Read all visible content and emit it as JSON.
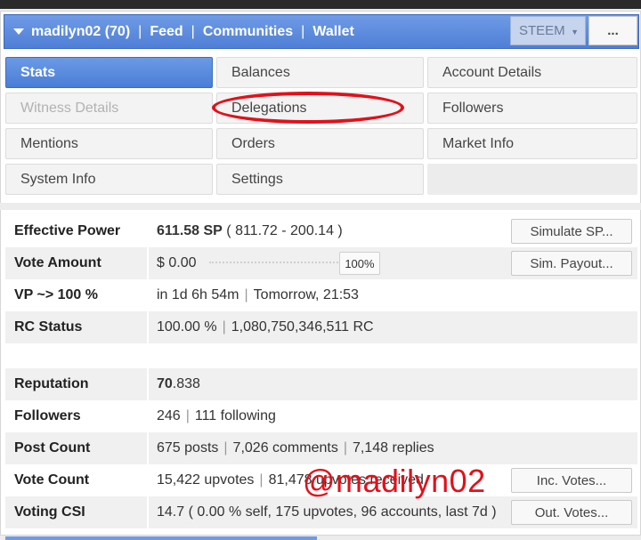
{
  "header": {
    "user": "madilyn02 (70)",
    "nav": [
      "Feed",
      "Communities",
      "Wallet"
    ],
    "separator": "|",
    "currency_select": "STEEM",
    "more_button": "..."
  },
  "tabs": [
    {
      "label": "Stats",
      "state": "active"
    },
    {
      "label": "Balances",
      "state": "normal"
    },
    {
      "label": "Account Details",
      "state": "normal"
    },
    {
      "label": "Witness Details",
      "state": "disabled"
    },
    {
      "label": "Delegations",
      "state": "normal"
    },
    {
      "label": "Followers",
      "state": "normal"
    },
    {
      "label": "Mentions",
      "state": "normal"
    },
    {
      "label": "Orders",
      "state": "normal"
    },
    {
      "label": "Market Info",
      "state": "normal"
    },
    {
      "label": "System Info",
      "state": "normal"
    },
    {
      "label": "Settings",
      "state": "normal"
    }
  ],
  "stats": {
    "effective_power": {
      "label": "Effective Power",
      "value": "611.58 SP",
      "detail": " ( 811.72 - 200.14 )",
      "button": "Simulate SP..."
    },
    "vote_amount": {
      "label": "Vote Amount",
      "value": "$ 0.00",
      "percent": "100%",
      "button": "Sim. Payout..."
    },
    "vp": {
      "label": "VP ~> 100 %",
      "time": "in 1d 6h 54m",
      "when": "Tomorrow, 21:53"
    },
    "rc_status": {
      "label": "RC Status",
      "percent": "100.00 %",
      "rc": "1,080,750,346,511 RC"
    },
    "reputation": {
      "label": "Reputation",
      "value_int": "70",
      "value_dec": ".838"
    },
    "followers": {
      "label": "Followers",
      "followers": "246",
      "following": "111 following"
    },
    "post_count": {
      "label": "Post Count",
      "posts": "675 posts",
      "comments": "7,026 comments",
      "replies": "7,148 replies"
    },
    "vote_count": {
      "label": "Vote Count",
      "upvotes": "15,422 upvotes",
      "received": "81,478 upvotes received",
      "button": "Inc. Votes..."
    },
    "voting_csi": {
      "label": "Voting CSI",
      "value": "14.7 ( 0.00 % self, 175 upvotes, 96 accounts, last 7d )",
      "button": "Out. Votes..."
    }
  },
  "annotation": {
    "watermark": "@madilyn02",
    "highlight_color": "#e3101a"
  },
  "colors": {
    "header_blue": "#5a88dc",
    "active_tab": "#5a8be0"
  }
}
